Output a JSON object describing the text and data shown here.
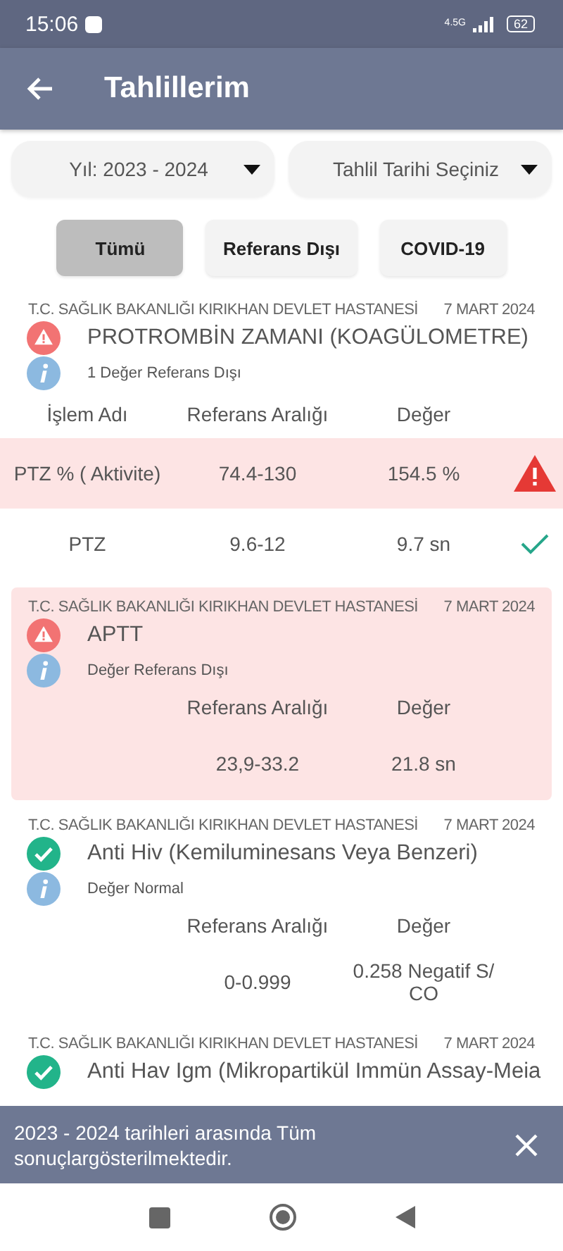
{
  "status_bar": {
    "time": "15:06",
    "network": "4.5G",
    "battery": "62"
  },
  "app_bar": {
    "title": "Tahlillerim"
  },
  "filters": [
    {
      "label": "Yıl: 2023 - 2024"
    },
    {
      "label": "Tahlil Tarihi Seçiniz"
    }
  ],
  "tabs": [
    {
      "label": "Tümü",
      "selected": true
    },
    {
      "label": "Referans Dışı",
      "selected": false
    },
    {
      "label": "COVID-19",
      "selected": false
    }
  ],
  "results": [
    {
      "hospital": "T.C. SAĞLIK BAKANLIĞI KIRIKHAN DEVLET HASTANESİ",
      "date": "7 MART 2024",
      "kind": "alert",
      "highlighted": false,
      "title": "PROTROMBİN ZAMANI (KOAGÜLOMETRE)",
      "summary": "1 Değer Referans Dışı",
      "headers": {
        "name": "İşlem Adı",
        "reference": "Referans Aralığı",
        "value": "Değer"
      },
      "rows": [
        {
          "name": "PTZ %  ( Aktivite)",
          "reference": "74.4-130",
          "value": "154.5 %",
          "kind": "alert"
        },
        {
          "name": "PTZ",
          "reference": "9.6-12",
          "value": "9.7 sn",
          "kind": "ok"
        }
      ]
    },
    {
      "hospital": "T.C. SAĞLIK BAKANLIĞI KIRIKHAN DEVLET HASTANESİ",
      "date": "7 MART 2024",
      "kind": "alert",
      "highlighted": true,
      "title": "APTT",
      "summary": "Değer Referans Dışı",
      "headers": {
        "reference": "Referans Aralığı",
        "value": "Değer"
      },
      "rows": [
        {
          "reference": "23,9-33.2",
          "value": "21.8 sn",
          "kind": "plain"
        }
      ]
    },
    {
      "hospital": "T.C. SAĞLIK BAKANLIĞI KIRIKHAN DEVLET HASTANESİ",
      "date": "7 MART 2024",
      "kind": "normal",
      "highlighted": false,
      "title": "Anti Hiv (Kemiluminesans Veya Benzeri)",
      "summary": "Değer Normal",
      "headers": {
        "reference": "Referans Aralığı",
        "value": "Değer"
      },
      "rows": [
        {
          "reference": "0-0.999",
          "value": "0.258 Negatif S/ CO",
          "kind": "plain"
        }
      ]
    },
    {
      "hospital": "T.C. SAĞLIK BAKANLIĞI KIRIKHAN DEVLET HASTANESİ",
      "date": "7 MART 2024",
      "kind": "normal",
      "highlighted": false,
      "title": "Anti Hav Igm (Mikropartikül Immün Assay-Meia"
    }
  ],
  "snackbar": {
    "message": "2023 - 2024 tarihleri arasında Tüm sonuçlargösterilmektedir."
  }
}
